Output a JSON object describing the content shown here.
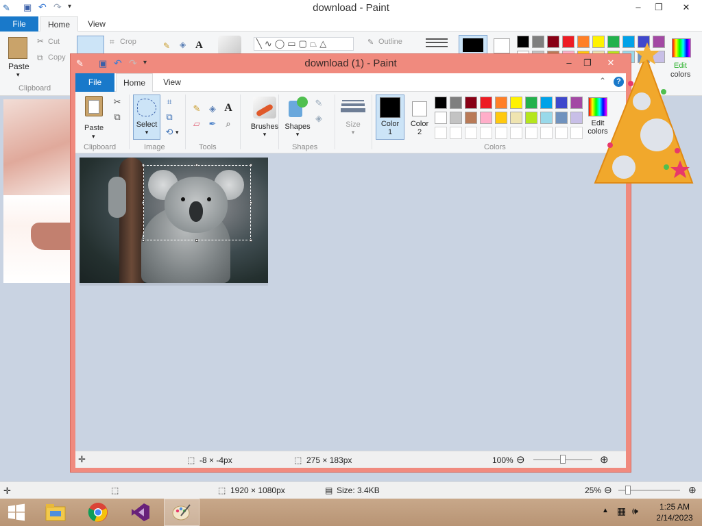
{
  "background_window": {
    "title": "download - Paint",
    "tabs": [
      "File",
      "Home",
      "View"
    ],
    "ribbon": {
      "paste": "Paste",
      "cut": "Cut",
      "copy": "Copy",
      "crop": "Crop",
      "outline": "Outline",
      "clipboard": "Clipboard",
      "edit_colors_line1": "Edit",
      "edit_colors_line2": "colors"
    },
    "status": {
      "image_size": "1920 × 1080px",
      "file_size": "Size: 3.4KB",
      "zoom": "25%"
    }
  },
  "foreground_window": {
    "title": "download (1) - Paint",
    "tabs": [
      "File",
      "Home",
      "View"
    ],
    "ribbon": {
      "paste": "Paste",
      "select": "Select",
      "brushes": "Brushes",
      "shapes": "Shapes",
      "size": "Size",
      "color1_line1": "Color",
      "color1_line2": "1",
      "color2_line1": "Color",
      "color2_line2": "2",
      "edit_colors_line1": "Edit",
      "edit_colors_line2": "colors",
      "groups": [
        "Clipboard",
        "Image",
        "Tools",
        "Shapes",
        "Colors"
      ]
    },
    "status": {
      "cursor_pos": "-8 × -4px",
      "selection_size": "275 × 183px",
      "zoom": "100%"
    }
  },
  "palette": {
    "row1": [
      "#000000",
      "#7f7f7f",
      "#880015",
      "#ed1c24",
      "#ff7f27",
      "#fff200",
      "#22b14c",
      "#00a2e8",
      "#3f48cc",
      "#a349a4"
    ],
    "row2": [
      "#ffffff",
      "#c3c3c3",
      "#b97a57",
      "#ffaec9",
      "#ffc90e",
      "#efe4b0",
      "#b5e61d",
      "#99d9ea",
      "#7092be",
      "#c8bfe7"
    ]
  },
  "colors": {
    "color1": "#000000",
    "color2": "#ffffff",
    "accent": "#1979ca",
    "window_frame": "#f08a7e"
  },
  "taskbar": {
    "apps": [
      "start-icon",
      "file-explorer-icon",
      "chrome-icon",
      "visual-studio-icon",
      "paint-icon"
    ],
    "time": "1:25 AM",
    "date": "2/14/2023"
  }
}
